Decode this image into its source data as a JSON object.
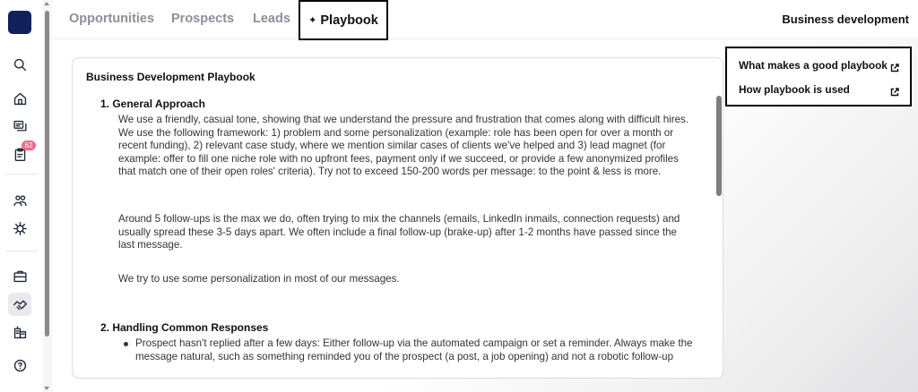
{
  "tabs": {
    "items": [
      "Opportunities",
      "Prospects",
      "Leads"
    ],
    "active": "Playbook",
    "active_icon": "sparkle-icon"
  },
  "header": {
    "section_title": "Business development"
  },
  "rail": {
    "badge_count": "62",
    "icons": [
      "search-icon",
      "home-icon",
      "messages-icon",
      "clipboard-icon",
      "people-icon",
      "bug-icon",
      "briefcase-icon",
      "handshake-icon",
      "buildings-icon",
      "help-icon"
    ]
  },
  "playbook": {
    "title": "Business Development Playbook",
    "section1_title": "1. General Approach",
    "section1_p1": "We use a friendly, casual tone, showing that we understand the pressure and frustration that comes along with difficult hires. We use the following framework: 1) problem and some personalization (example: role has been open for over a month or recent funding), 2) relevant case study, where we mention similar cases of clients we've helped and 3) lead magnet (for example: offer to fill one niche role with no upfront fees, payment only if we succeed, or provide a few anonymized profiles that match one of their open roles' criteria). Try not to exceed 150-200 words per message: to the point & less is more.",
    "section1_p2": "Around 5 follow-ups is the max we do, often trying to mix the channels (emails, LinkedIn inmails, connection requests) and usually spread these 3-5 days apart. We often include a final follow-up (brake-up) after 1-2 months have passed since the last message.",
    "section1_p3": "We try to use some personalization in most of our messages.",
    "section2_title": "2. Handling Common Responses",
    "section2_bullet1": "Prospect hasn't replied after a few days: Either follow-up via the automated campaign or set a reminder. Always make the message natural, such as something reminded you of the prospect (a post, a job opening) and not a robotic follow-up"
  },
  "links": {
    "items": [
      {
        "label": "What makes a good playbook",
        "icon": "external-link-icon"
      },
      {
        "label": "How playbook is used",
        "icon": "external-link-icon"
      }
    ]
  },
  "colors": {
    "logo": "#13205e",
    "badge": "#f06a8e",
    "muted_tab": "#8b8f98"
  }
}
